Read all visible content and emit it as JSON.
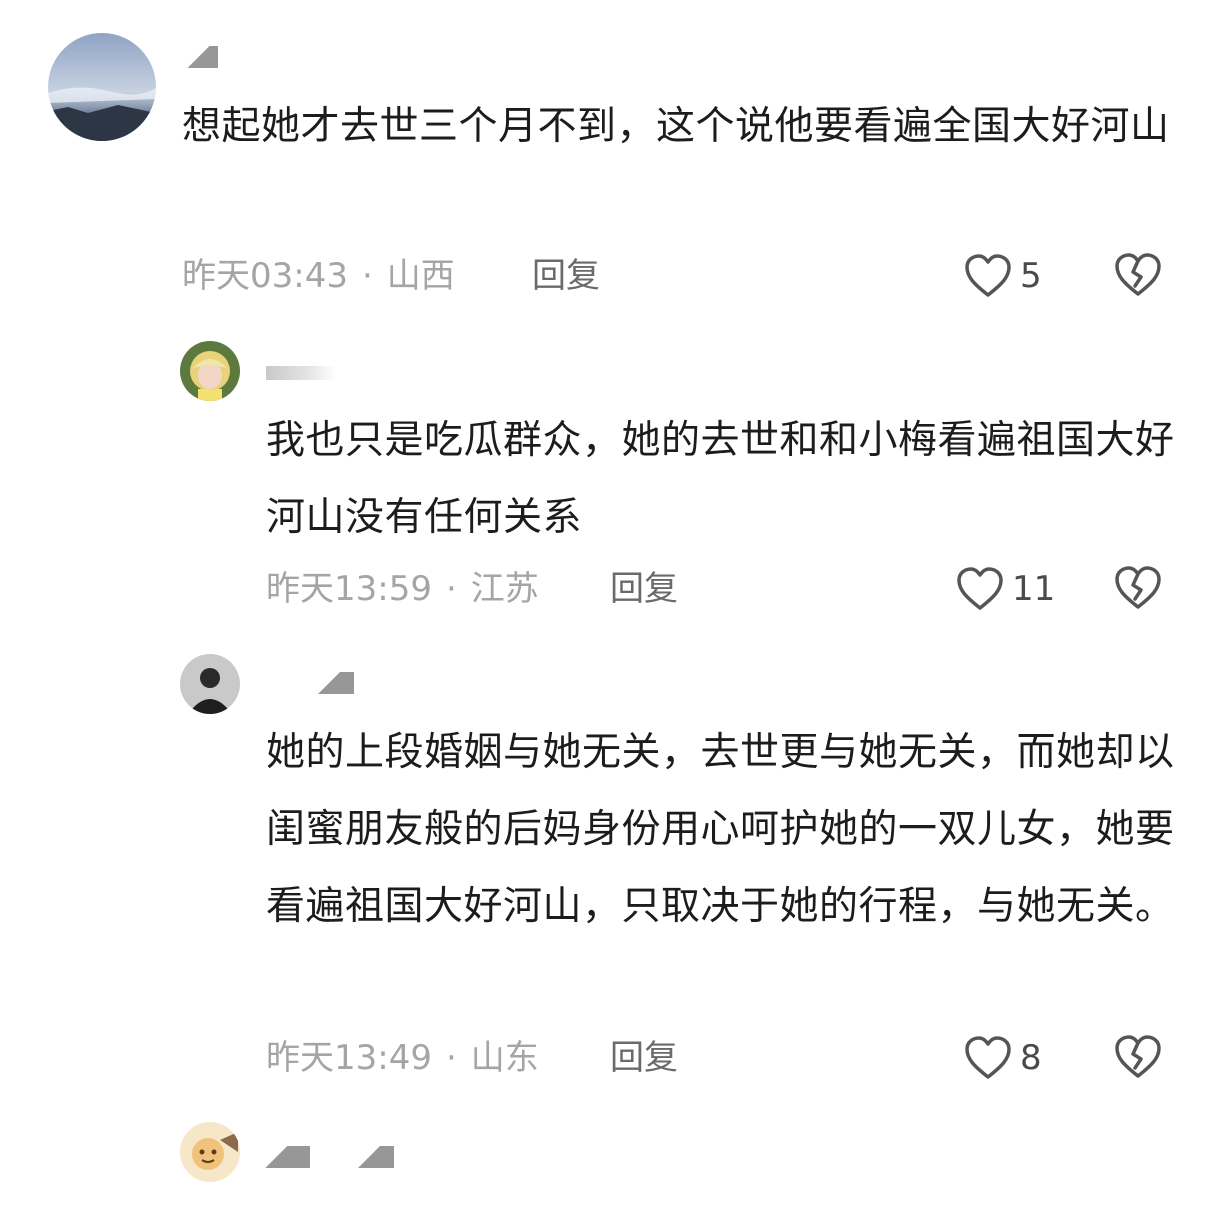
{
  "comments": [
    {
      "text": "想起她才去世三个月不到，这个说他要看遍全国大好河山",
      "time": "昨天03:43",
      "location": "山西",
      "reply_label": "回复",
      "likes": "5"
    },
    {
      "text": "我也只是吃瓜群众，她的去世和和小梅看遍祖国大好河山没有任何关系",
      "time": "昨天13:59",
      "location": "江苏",
      "reply_label": "回复",
      "likes": "11"
    },
    {
      "text": "她的上段婚姻与她无关，去世更与她无关，而她却以闺蜜朋友般的后妈身份用心呵护她的一双儿女，她要看遍祖国大好河山，只取决于她的行程，与她无关。",
      "time": "昨天13:49",
      "location": "山东",
      "reply_label": "回复",
      "likes": "8"
    }
  ],
  "separator": "·",
  "icons": {
    "like": "heart-outline-icon",
    "dislike": "broken-heart-icon"
  },
  "colors": {
    "text": "#1c1c1c",
    "meta": "#a5a5a5",
    "icon": "#555555"
  }
}
